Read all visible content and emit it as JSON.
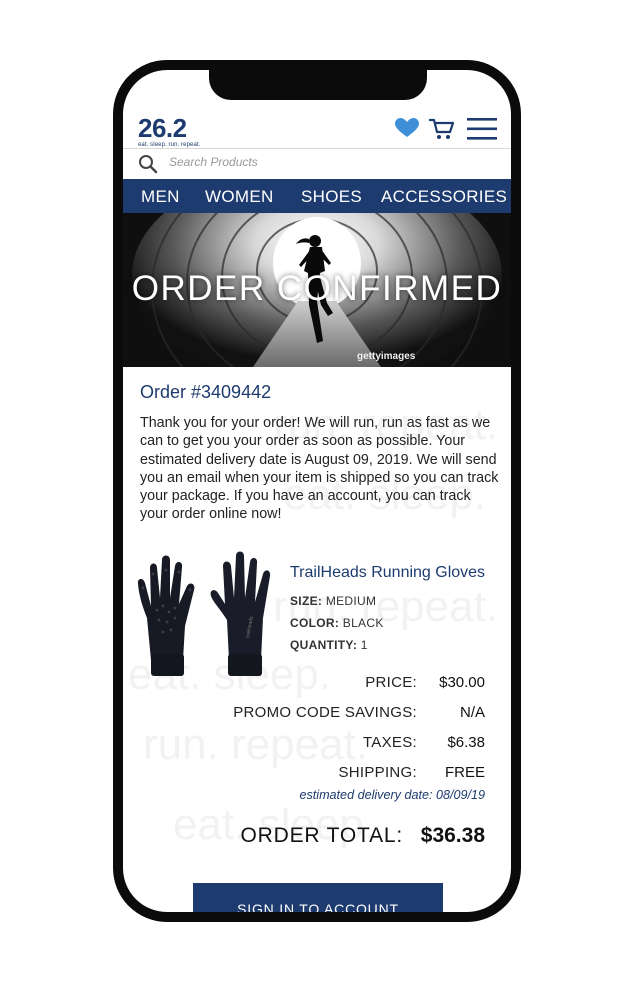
{
  "brand": {
    "name": "26.2",
    "tagline": "eat. sleep. run. repeat."
  },
  "header": {
    "icons": [
      "heart-icon",
      "cart-icon",
      "hamburger-menu-icon"
    ]
  },
  "search": {
    "placeholder": "Search Products"
  },
  "nav": {
    "items": [
      "MEN",
      "WOMEN",
      "SHOES",
      "ACCESSORIES"
    ]
  },
  "hero": {
    "title": "ORDER CONFIRMED",
    "credit": "gettyimages"
  },
  "order": {
    "number_label": "Order #3409442",
    "message": "Thank you for your order! We will run, run as fast as we can to get you your order as soon as possible. Your estimated delivery date is August 09, 2019. We will send you an email when your item is shipped so you can track your package. If you have an account, you can track your order online now!"
  },
  "product": {
    "name": "TrailHeads Running Gloves",
    "size_label": "SIZE:",
    "size_value": "MEDIUM",
    "color_label": "COLOR:",
    "color_value": "BLACK",
    "quantity_label": "QUANTITY:",
    "quantity_value": "1"
  },
  "summary": {
    "price_label": "PRICE:",
    "price_value": "$30.00",
    "promo_label": "PROMO CODE SAVINGS:",
    "promo_value": "N/A",
    "taxes_label": "TAXES:",
    "taxes_value": "$6.38",
    "shipping_label": "SHIPPING:",
    "shipping_value": "FREE",
    "delivery": "estimated delivery date: 08/09/19",
    "total_label": "ORDER TOTAL:",
    "total_value": "$36.38"
  },
  "cta": {
    "signin_label": "SIGN IN TO ACCOUNT"
  },
  "colors": {
    "brand_blue": "#1d3b6e",
    "heart_blue": "#3f8fd8"
  }
}
